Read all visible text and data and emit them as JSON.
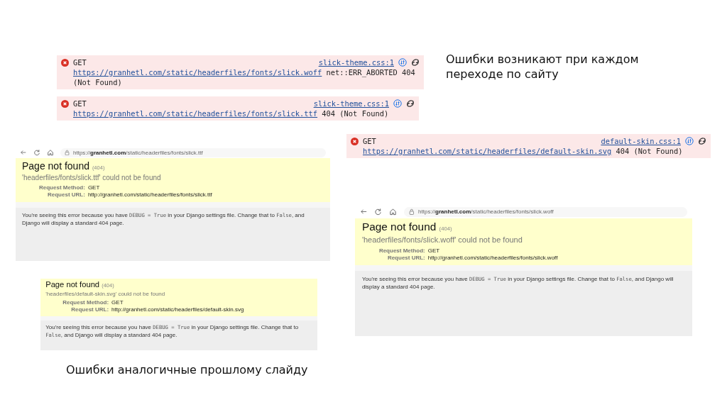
{
  "console_errors": [
    {
      "method": "GET",
      "source": "slick-theme.css:1",
      "url": "https://granhetl.com/static/headerfiles/fonts/slick.woff",
      "message": "net::ERR_ABORTED 404 (Not Found)"
    },
    {
      "method": "GET",
      "source": "slick-theme.css:1",
      "url": "https://granhetl.com/static/headerfiles/fonts/slick.ttf",
      "message": "404 (Not Found)"
    },
    {
      "method": "GET",
      "source": "default-skin.css:1",
      "url": "https://granhetl.com/static/headerfiles/default-skin.svg",
      "message": "404 (Not Found)"
    }
  ],
  "notes": [
    "Ошибки возникают при каждом переходе по сайту",
    "Ошибки аналогичные прошлому слайду"
  ],
  "error_pages": [
    {
      "address": "https://**granhetl.com**/static/headerfiles/fonts/slick.ttf",
      "title": "Page not found",
      "code": "(404)",
      "subtitle": "'headerfiles/fonts/slick.ttf' could not be found",
      "method_label": "Request Method:",
      "method": "GET",
      "url_label": "Request URL:",
      "url": "http://granhetl.com/static/headerfiles/fonts/slick.ttf",
      "debug": [
        {
          "kind": "text",
          "text": "You're seeing this error because you have "
        },
        {
          "kind": "code",
          "text": "DEBUG = True"
        },
        {
          "kind": "text",
          "text": " in your Django settings file. Change that to "
        },
        {
          "kind": "code",
          "text": "False"
        },
        {
          "kind": "text",
          "text": ", and Django will display a standard 404 page."
        }
      ]
    },
    {
      "address": "https://**granhetl.com**/static/headerfiles/fonts/slick.woff",
      "title": "Page not found",
      "code": "(404)",
      "subtitle": "'headerfiles/fonts/slick.woff' could not be found",
      "method_label": "Request Method:",
      "method": "GET",
      "url_label": "Request URL:",
      "url": "http://granhetl.com/static/headerfiles/fonts/slick.woff",
      "debug": [
        {
          "kind": "text",
          "text": "You're seeing this error because you have "
        },
        {
          "kind": "code",
          "text": "DEBUG = True"
        },
        {
          "kind": "text",
          "text": " in your Django settings file. Change that to "
        },
        {
          "kind": "code",
          "text": "False"
        },
        {
          "kind": "text",
          "text": ", and Django will display a standard 404 page."
        }
      ]
    },
    {
      "title": "Page not found",
      "code": "(404)",
      "subtitle": "'headerfiles/default-skin.svg' could not be found",
      "method_label": "Request Method:",
      "method": "GET",
      "url_label": "Request URL:",
      "url": "http://granhetl.com/static/headerfiles/default-skin.svg",
      "debug": [
        {
          "kind": "text",
          "text": "You're seeing this error because you have "
        },
        {
          "kind": "code",
          "text": "DEBUG = True"
        },
        {
          "kind": "text",
          "text": " in your Django settings file. Change that to "
        },
        {
          "kind": "code",
          "text": "False"
        },
        {
          "kind": "text",
          "text": ", and Django will display a standard 404 page."
        }
      ]
    }
  ]
}
